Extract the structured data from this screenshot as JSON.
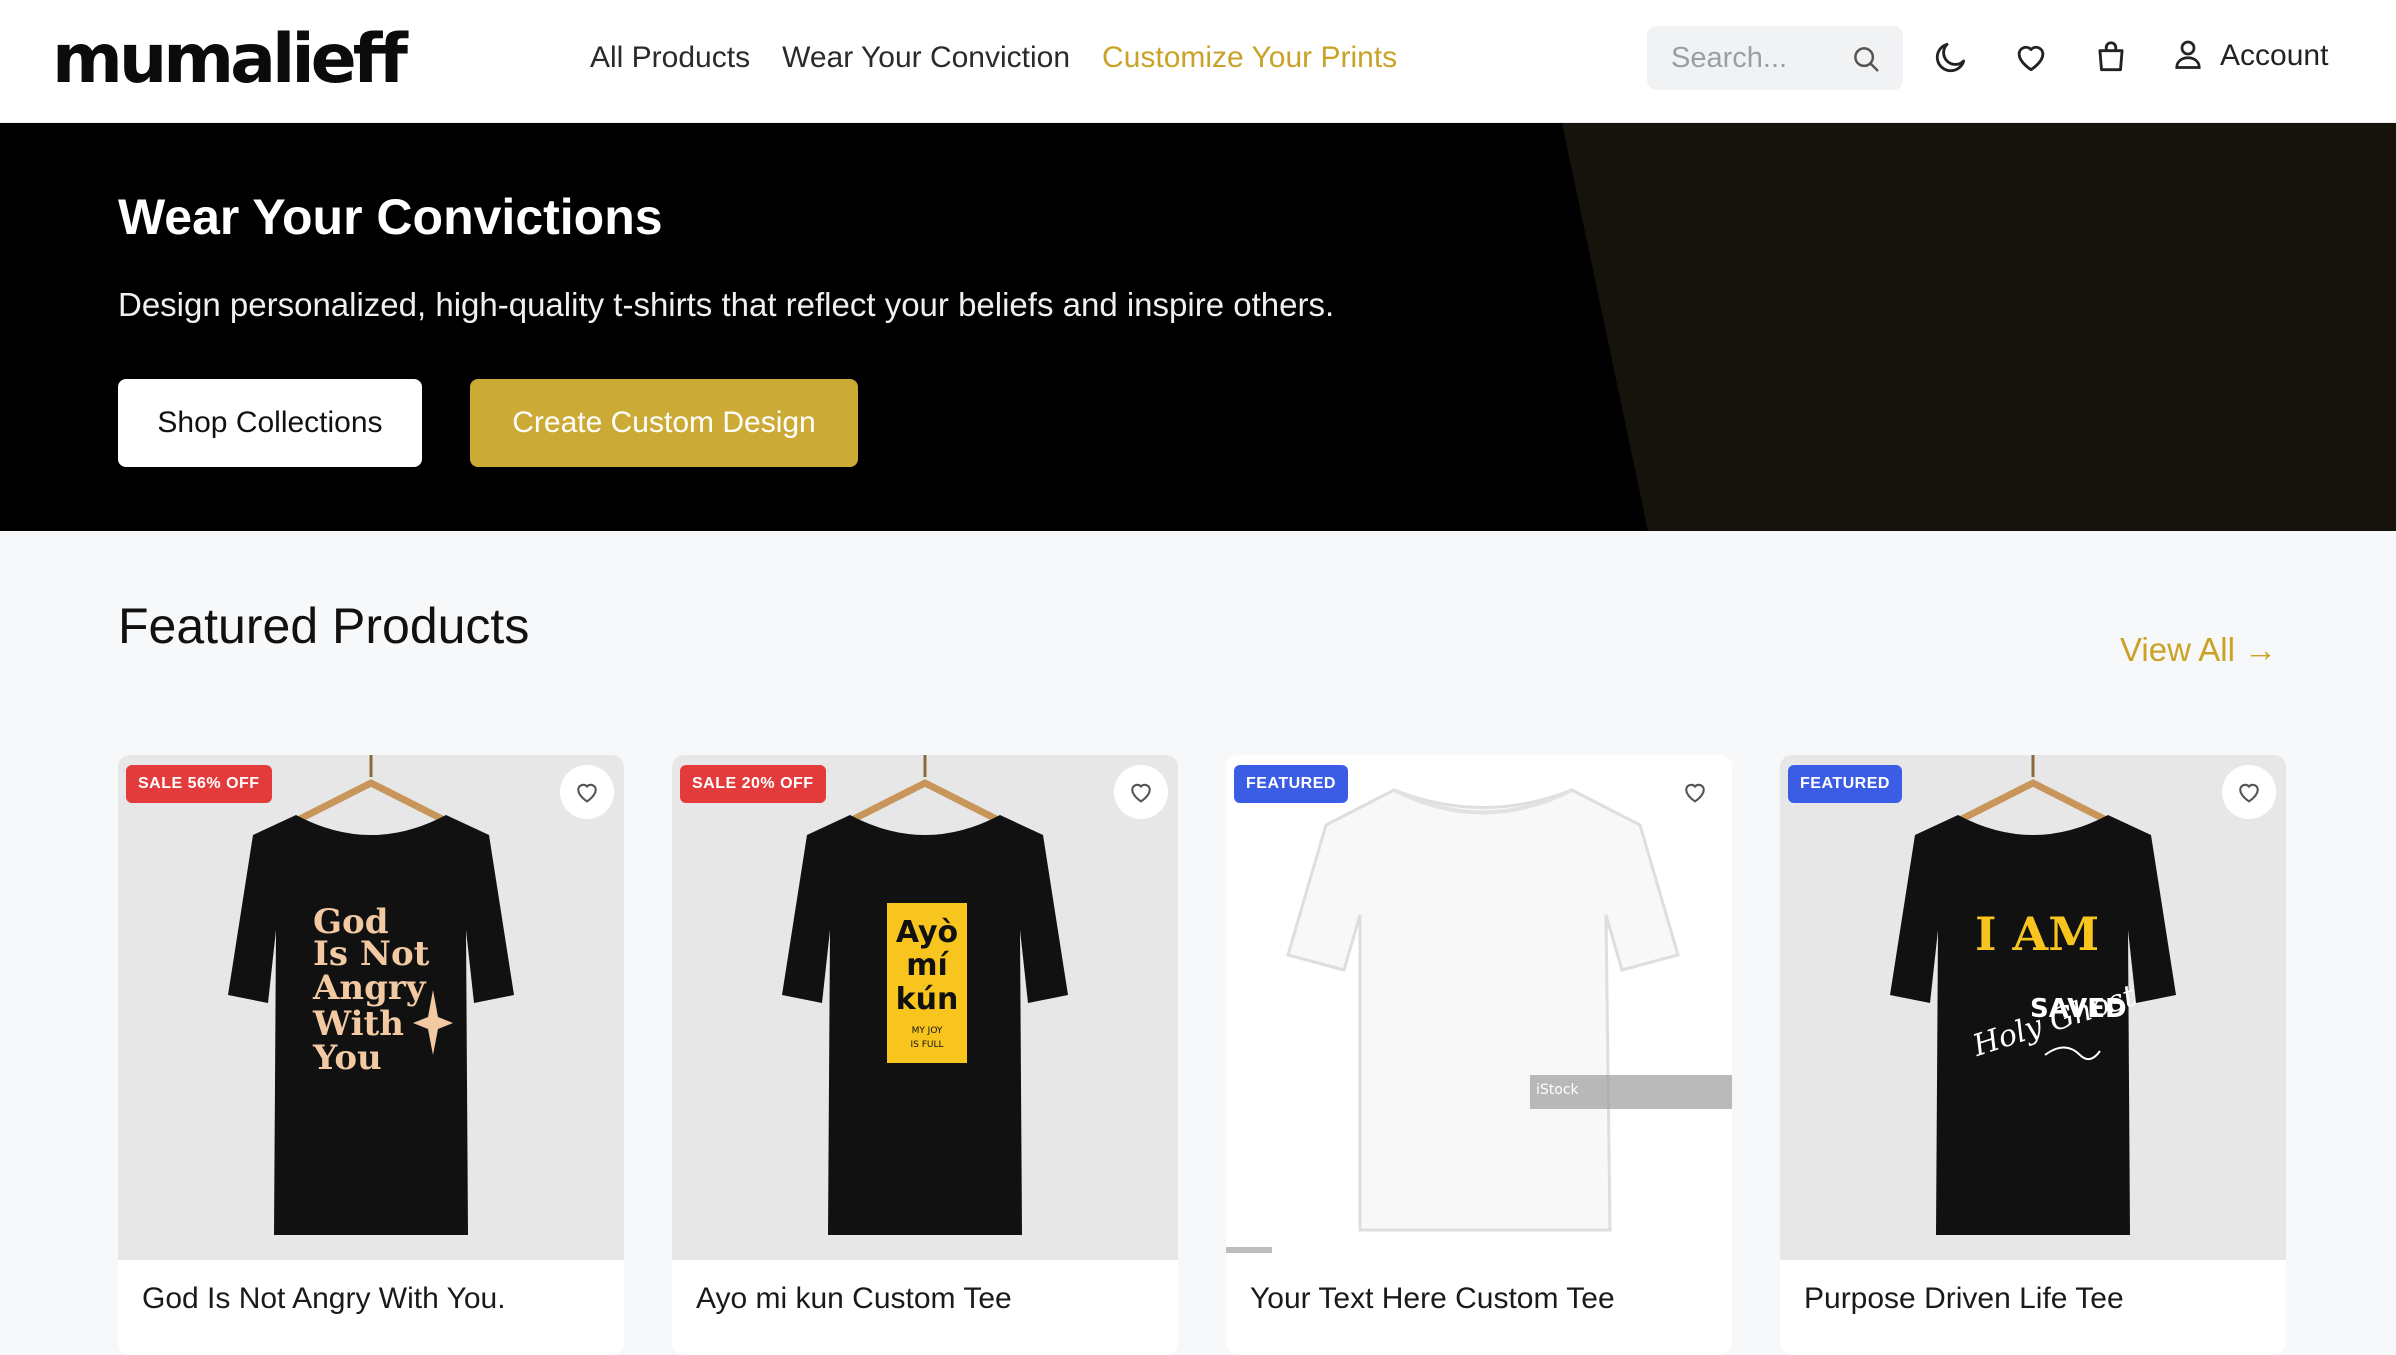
{
  "brand": {
    "logo_text": "mumalieff"
  },
  "nav": {
    "items": [
      {
        "label": "All Products"
      },
      {
        "label": "Wear Your Conviction"
      },
      {
        "label": "Customize Your Prints"
      }
    ],
    "active_index": 2
  },
  "search": {
    "placeholder": "Search..."
  },
  "header_icons": [
    "moon-icon",
    "heart-icon",
    "shopping-bag-icon",
    "user-icon"
  ],
  "account": {
    "label": "Account"
  },
  "hero": {
    "title": "Wear Your Convictions",
    "subtitle": "Design personalized, high-quality t-shirts that reflect your beliefs and inspire others.",
    "primary_button": "Shop Collections",
    "secondary_button": "Create Custom Design"
  },
  "featured": {
    "title": "Featured Products",
    "view_all": "View All →",
    "products": [
      {
        "name": "God Is Not Angry With You.",
        "badge": "SALE 56% OFF",
        "badge_type": "sale",
        "print_lines": [
          "God",
          "Is Not",
          "Angry",
          "With",
          "You"
        ]
      },
      {
        "name": "Ayo mi kun Custom Tee",
        "badge": "SALE 20% OFF",
        "badge_type": "sale",
        "print_lines": [
          "Ayò",
          "mí",
          "kún"
        ],
        "print_small": [
          "MY JOY",
          "IS FULL"
        ]
      },
      {
        "name": "Your Text Here Custom Tee",
        "badge": "FEATURED",
        "badge_type": "featured",
        "watermark": "iStock"
      },
      {
        "name": "Purpose Driven Life Tee",
        "badge": "FEATURED",
        "badge_type": "featured",
        "print_lines": [
          "I AM",
          "SAVED"
        ],
        "print_script": "Holy Ghost"
      }
    ]
  },
  "colors": {
    "accent": "#c9a227",
    "button_gold": "#ccaa36",
    "sale_badge": "#e33b3b",
    "featured_badge": "#3b5de6",
    "hero_bg": "#000000"
  }
}
